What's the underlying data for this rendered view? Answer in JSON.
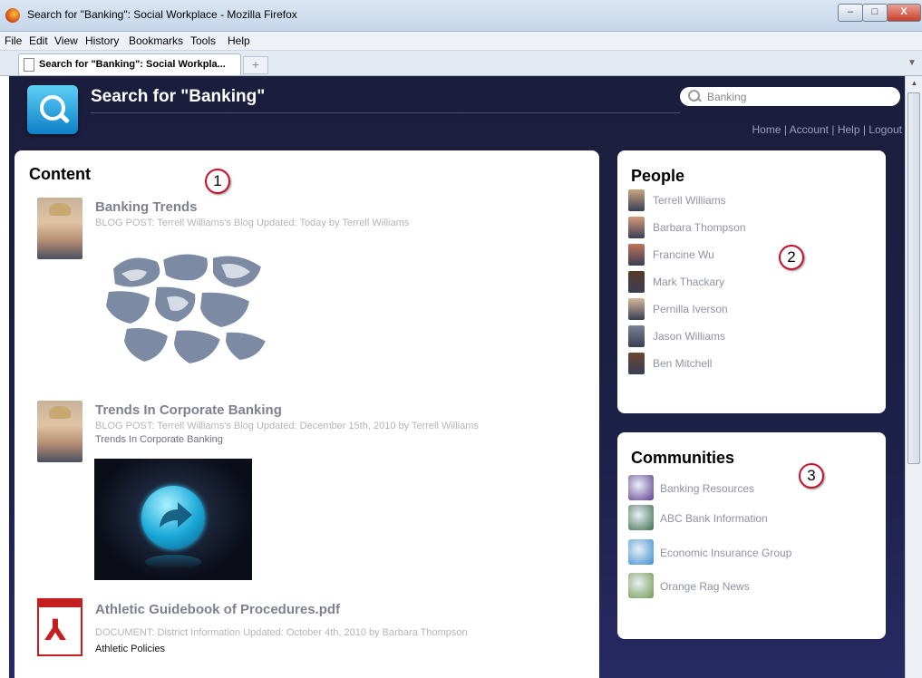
{
  "window": {
    "title": "Search for \"Banking\": Social Workplace - Mozilla Firefox",
    "min_label": "–",
    "max_label": "□",
    "close_label": "X"
  },
  "menu": [
    "File",
    "Edit",
    "View",
    "History",
    "Bookmarks",
    "Tools",
    "Help"
  ],
  "tab": {
    "label": "Search for \"Banking\": Social Workpla...",
    "new_tab": "+"
  },
  "header": {
    "title": "Search for \"Banking\"",
    "search_value": "Banking",
    "nav": [
      "Home",
      "Account",
      "Help",
      "Logout"
    ]
  },
  "content": {
    "title": "Content",
    "callout": "1",
    "items": [
      {
        "title": "Banking Trends",
        "meta": "BLOG POST: Terrell Williams's Blog Updated: Today by Terrell Williams"
      },
      {
        "title": "Trends In Corporate Banking",
        "meta": "BLOG POST: Terrell Williams's Blog Updated: December 15th, 2010 by Terrell Williams",
        "sub": "Trends In Corporate Banking"
      },
      {
        "title": "Athletic Guidebook of Procedures.pdf",
        "meta": "DOCUMENT: District Information Updated: October 4th, 2010 by Barbara Thompson",
        "sub": "Athletic Policies"
      }
    ]
  },
  "people": {
    "title": "People",
    "callout": "2",
    "list": [
      {
        "name": "Terrell Williams",
        "color": "#c9a47e"
      },
      {
        "name": "Barbara Thompson",
        "color": "#d59a7c"
      },
      {
        "name": "Francine Wu",
        "color": "#c0735a"
      },
      {
        "name": "Mark Thackary",
        "color": "#5a3a28"
      },
      {
        "name": "Pernilla Iverson",
        "color": "#d9b89a"
      },
      {
        "name": "Jason Williams",
        "color": "#7b8294"
      },
      {
        "name": "Ben Mitchell",
        "color": "#6a4632"
      }
    ]
  },
  "communities": {
    "title": "Communities",
    "callout": "3",
    "list": [
      {
        "name": "Banking Resources",
        "color": "#5d3d8f"
      },
      {
        "name": "ABC Bank Information",
        "color": "#3d6e4a"
      },
      {
        "name": "Economic Insurance Group",
        "color": "#3a8fd0"
      },
      {
        "name": "Orange Rag News",
        "color": "#6f9a4a"
      }
    ]
  }
}
